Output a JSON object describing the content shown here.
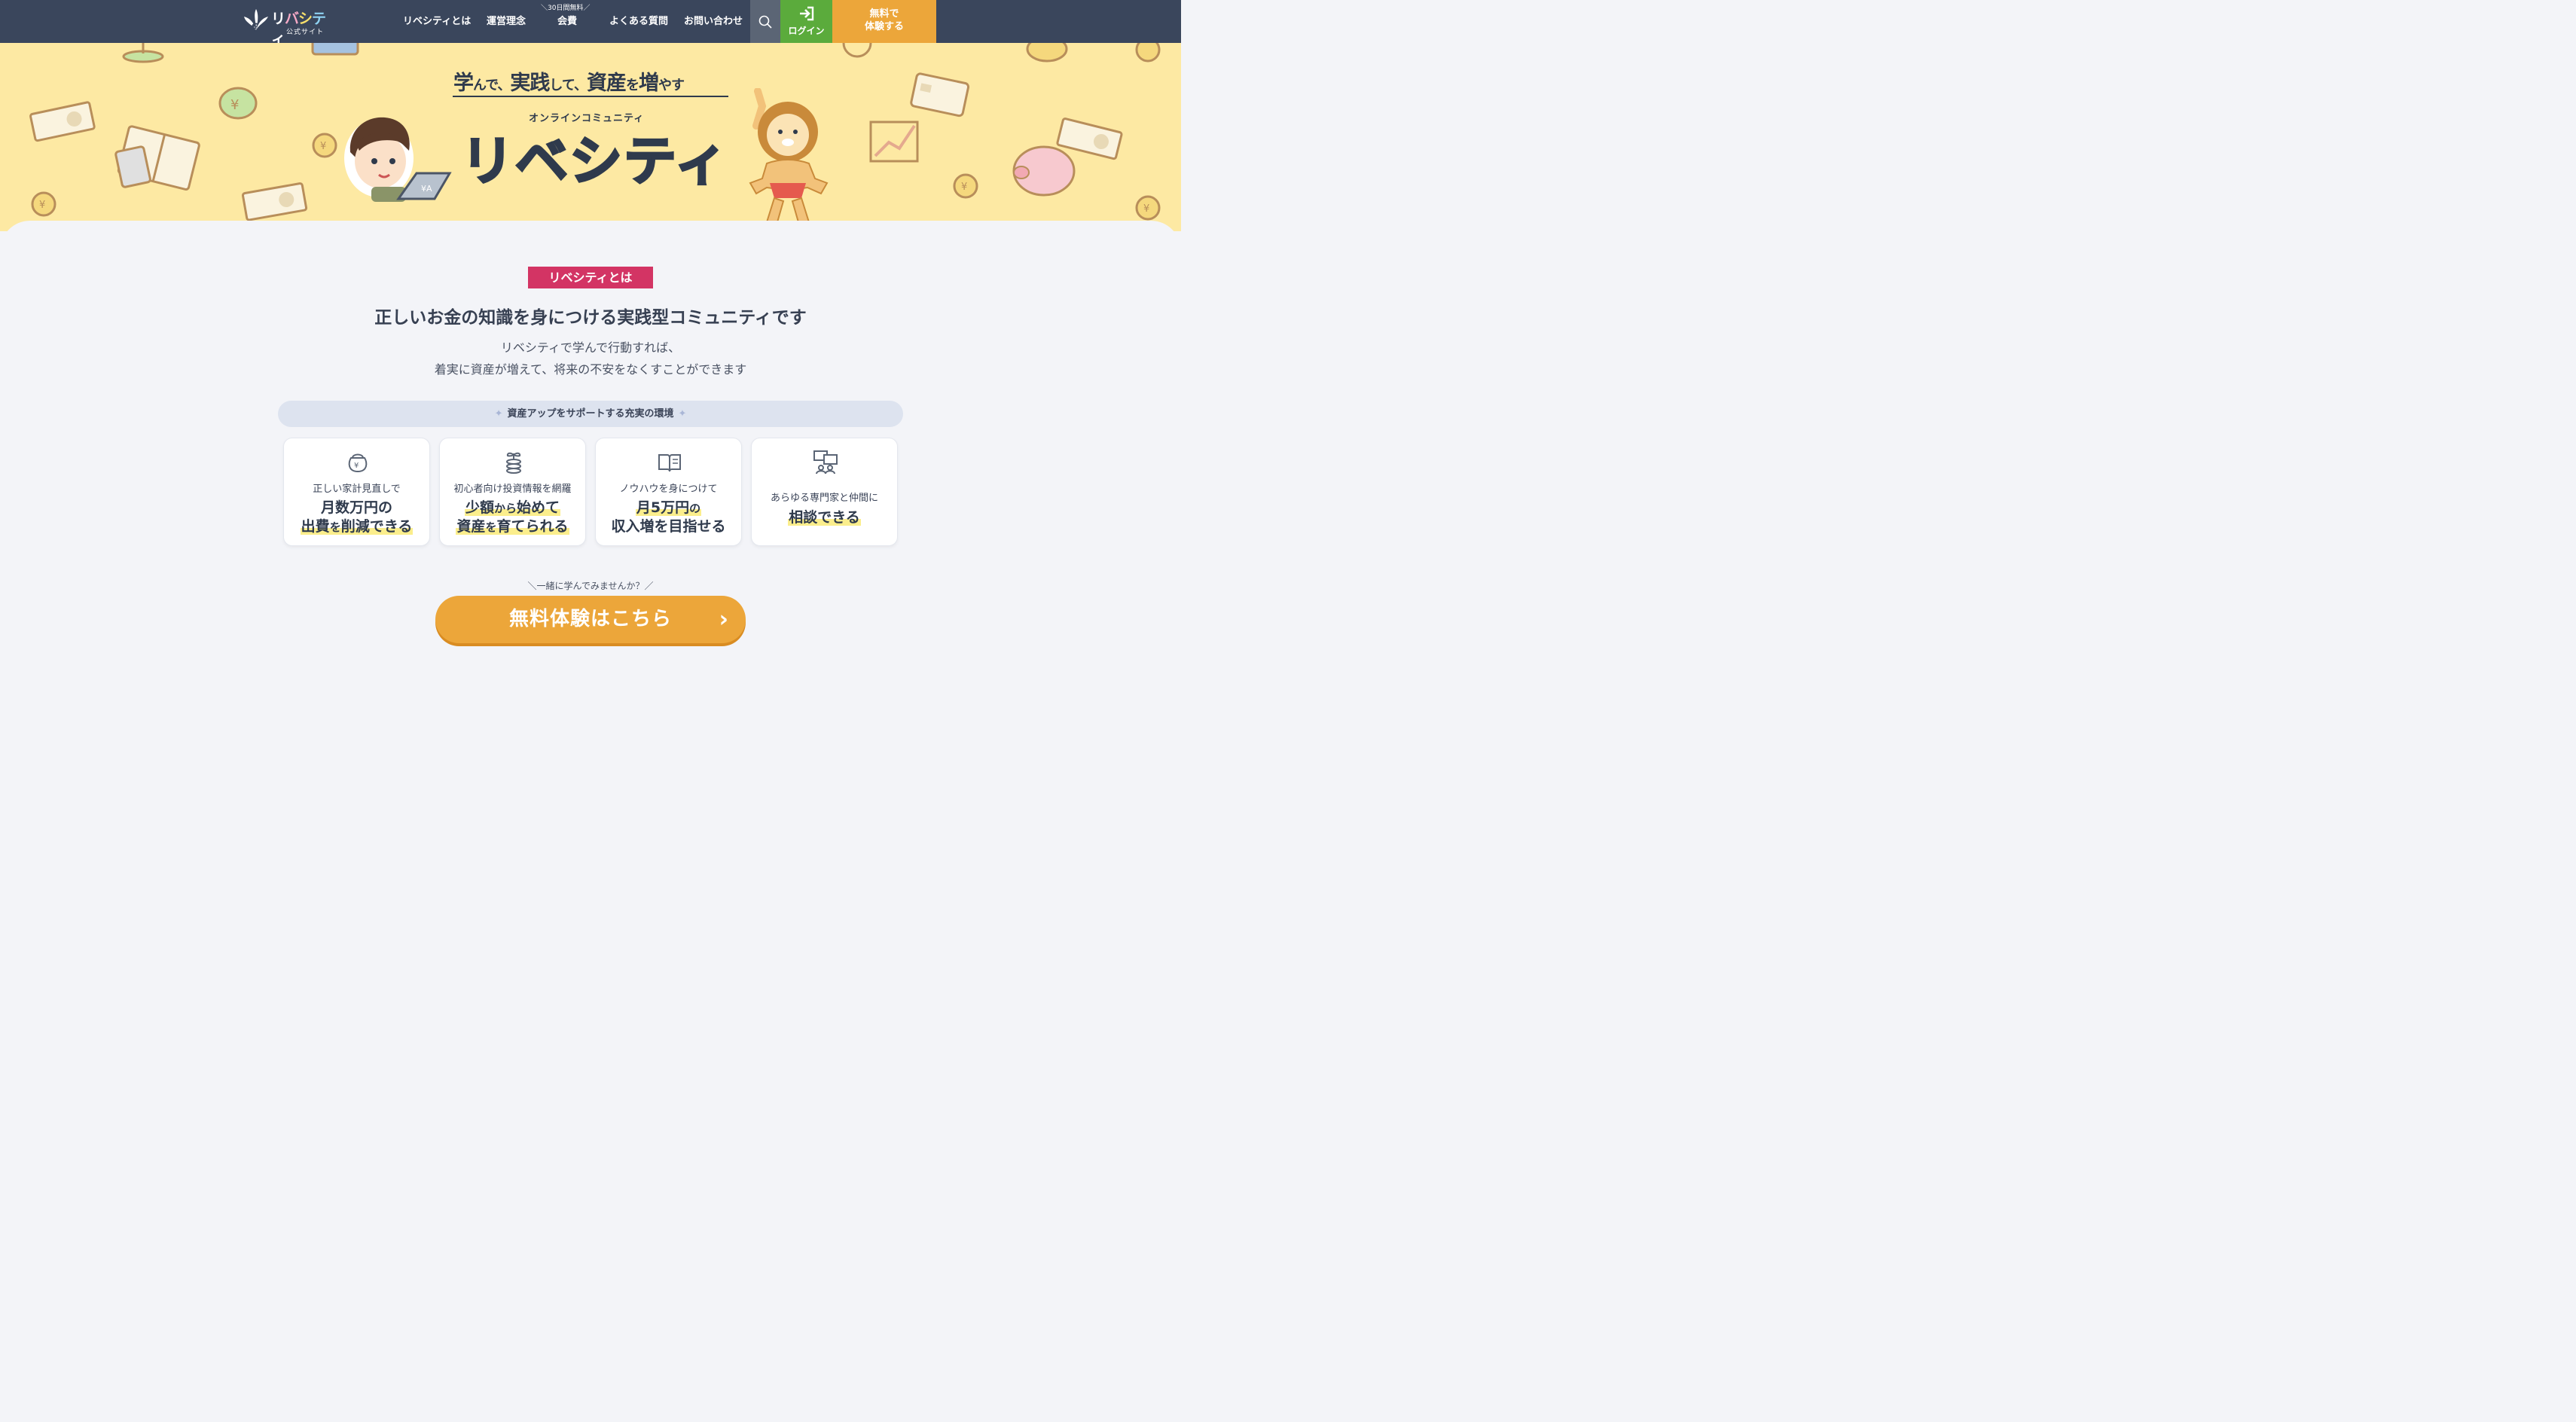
{
  "header": {
    "logo_text": [
      "リ",
      "バ",
      "シ",
      "テ",
      "ィ"
    ],
    "logo_colors": [
      "#ffffff",
      "#f5a9c6",
      "#f7df6b",
      "#8fd3f3",
      "#ffffff"
    ],
    "logo_sub": "公式サイト",
    "nav": {
      "about": "リベシティとは",
      "philosophy": "運営理念",
      "fee_badge": "＼30日間無料／",
      "fee": "会費",
      "faq": "よくある質問",
      "contact": "お問い合わせ"
    },
    "login_label": "ログイン",
    "trial_line1": "無料で",
    "trial_line2": "体験する"
  },
  "hero": {
    "tagline_parts": [
      "学",
      "んで、",
      "実践",
      "して、",
      "資産",
      "を",
      "増",
      "やす"
    ],
    "community_sub": "オンラインコミュニティ",
    "title": "リベシティ"
  },
  "about": {
    "badge": "リベシティとは",
    "headline": "正しいお金の知識を身につける実践型コミュニティです",
    "desc_line1": "リベシティで学んで行動すれば、",
    "desc_line2": "着実に資産が増えて、将来の不安をなくすことができます",
    "env_label": "資産アップをサポートする充実の環境",
    "cards": [
      {
        "icon": "wallet-icon",
        "small": "正しい家計見直しで",
        "big1": "月数万円の",
        "big2a": "出費",
        "big2b": "を",
        "big2c": "削減できる"
      },
      {
        "icon": "coins-sprout-icon",
        "small": "初心者向け投資情報を網羅",
        "big1a": "少額",
        "big1b": "から",
        "big1c": "始めて",
        "big2a": "資産",
        "big2b": "を",
        "big2c": "育てられる"
      },
      {
        "icon": "book-icon",
        "small": "ノウハウを身につけて",
        "big1a": "月5万円",
        "big1b": "の",
        "big2": "収入増を目指せる"
      },
      {
        "icon": "chat-people-icon",
        "small": "あらゆる専門家と仲間に",
        "big1": "相談できる"
      }
    ],
    "cta_note": "＼一緒に学んでみませんか？／",
    "cta_label": "無料体験はこちら"
  }
}
